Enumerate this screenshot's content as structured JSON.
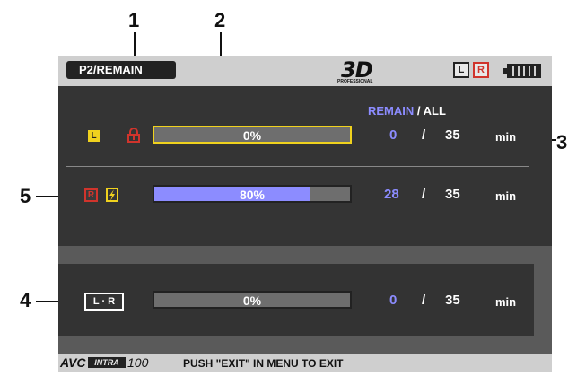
{
  "callouts": [
    "1",
    "2",
    "3",
    "4",
    "5"
  ],
  "header": {
    "title": "P2/REMAIN",
    "logo_3d": "3D",
    "logo_sub": "PROFESSIONAL",
    "indicator_l": "L",
    "indicator_r": "R"
  },
  "columns": {
    "remain": "REMAIN",
    "slash": " / ",
    "all": "ALL"
  },
  "rows": [
    {
      "chip": "L",
      "percent_label": "0%",
      "fill": 0.0,
      "remain": "0",
      "slash": "/",
      "all": "35",
      "unit": "min"
    },
    {
      "chip": "R",
      "percent_label": "80%",
      "fill": 0.8,
      "remain": "28",
      "slash": "/",
      "all": "35",
      "unit": "min"
    },
    {
      "chip": "L · R",
      "percent_label": "0%",
      "fill": 0.0,
      "remain": "0",
      "slash": "/",
      "all": "35",
      "unit": "min"
    }
  ],
  "footer": {
    "avc": "AVC",
    "intra": "INTRA",
    "avc100": "100",
    "message": "PUSH \"EXIT\" IN MENU TO EXIT"
  },
  "colors": {
    "accent_blue": "#8c8cff",
    "lock_red": "#d0342c",
    "warn_yellow": "#f0d21e"
  }
}
